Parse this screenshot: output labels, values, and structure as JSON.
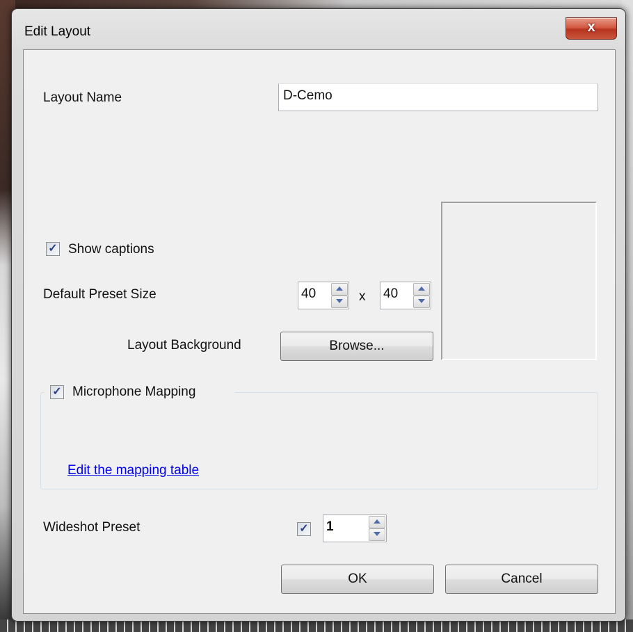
{
  "window": {
    "title": "Edit Layout",
    "close_glyph": "x"
  },
  "form": {
    "layout_name_label": "Layout Name",
    "layout_name_value": "D-Cemo",
    "show_captions_label": "Show captions",
    "show_captions_checked": true,
    "default_preset_size_label": "Default Preset Size",
    "preset_width": "40",
    "preset_height": "40",
    "size_separator": "x",
    "layout_background_label": "Layout Background",
    "browse_label": "Browse...",
    "microphone_mapping_label": "Microphone Mapping",
    "microphone_mapping_checked": true,
    "edit_mapping_link": "Edit the mapping table",
    "wideshot_preset_label": "Wideshot Preset",
    "wideshot_checked": true,
    "wideshot_value": "1"
  },
  "buttons": {
    "ok": "OK",
    "cancel": "Cancel"
  },
  "colors": {
    "link": "#0000ee",
    "close_button": "#c8553c",
    "client_bg": "#f0f0f0"
  },
  "icons": {
    "check": "checkmark-icon",
    "spin_up": "arrow-up-icon",
    "spin_down": "arrow-down-icon",
    "close": "close-icon"
  }
}
